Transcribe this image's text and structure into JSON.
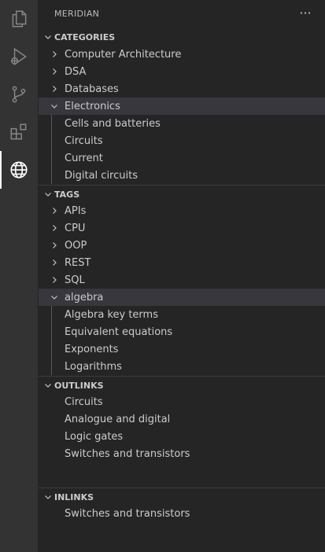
{
  "sidebar": {
    "title": "MERIDIAN",
    "more_label": "···"
  },
  "categories": {
    "header": "CATEGORIES",
    "items": [
      {
        "label": "Computer Architecture"
      },
      {
        "label": "DSA"
      },
      {
        "label": "Databases"
      },
      {
        "label": "Electronics",
        "children": [
          "Cells and batteries",
          "Circuits",
          "Current",
          "Digital circuits"
        ]
      }
    ]
  },
  "tags": {
    "header": "TAGS",
    "items": [
      {
        "label": "APIs"
      },
      {
        "label": "CPU"
      },
      {
        "label": "OOP"
      },
      {
        "label": "REST"
      },
      {
        "label": "SQL"
      },
      {
        "label": "algebra",
        "children": [
          "Algebra key terms",
          "Equivalent equations",
          "Exponents",
          "Logarithms"
        ]
      }
    ]
  },
  "outlinks": {
    "header": "OUTLINKS",
    "items": [
      "Circuits",
      "Analogue and digital",
      "Logic gates",
      "Switches and transistors"
    ]
  },
  "inlinks": {
    "header": "INLINKS",
    "items": [
      "Switches and transistors"
    ]
  },
  "colors": {
    "activity_bar": "#333333",
    "sidebar": "#252526",
    "selection": "#37373d",
    "text": "#cccccc"
  }
}
